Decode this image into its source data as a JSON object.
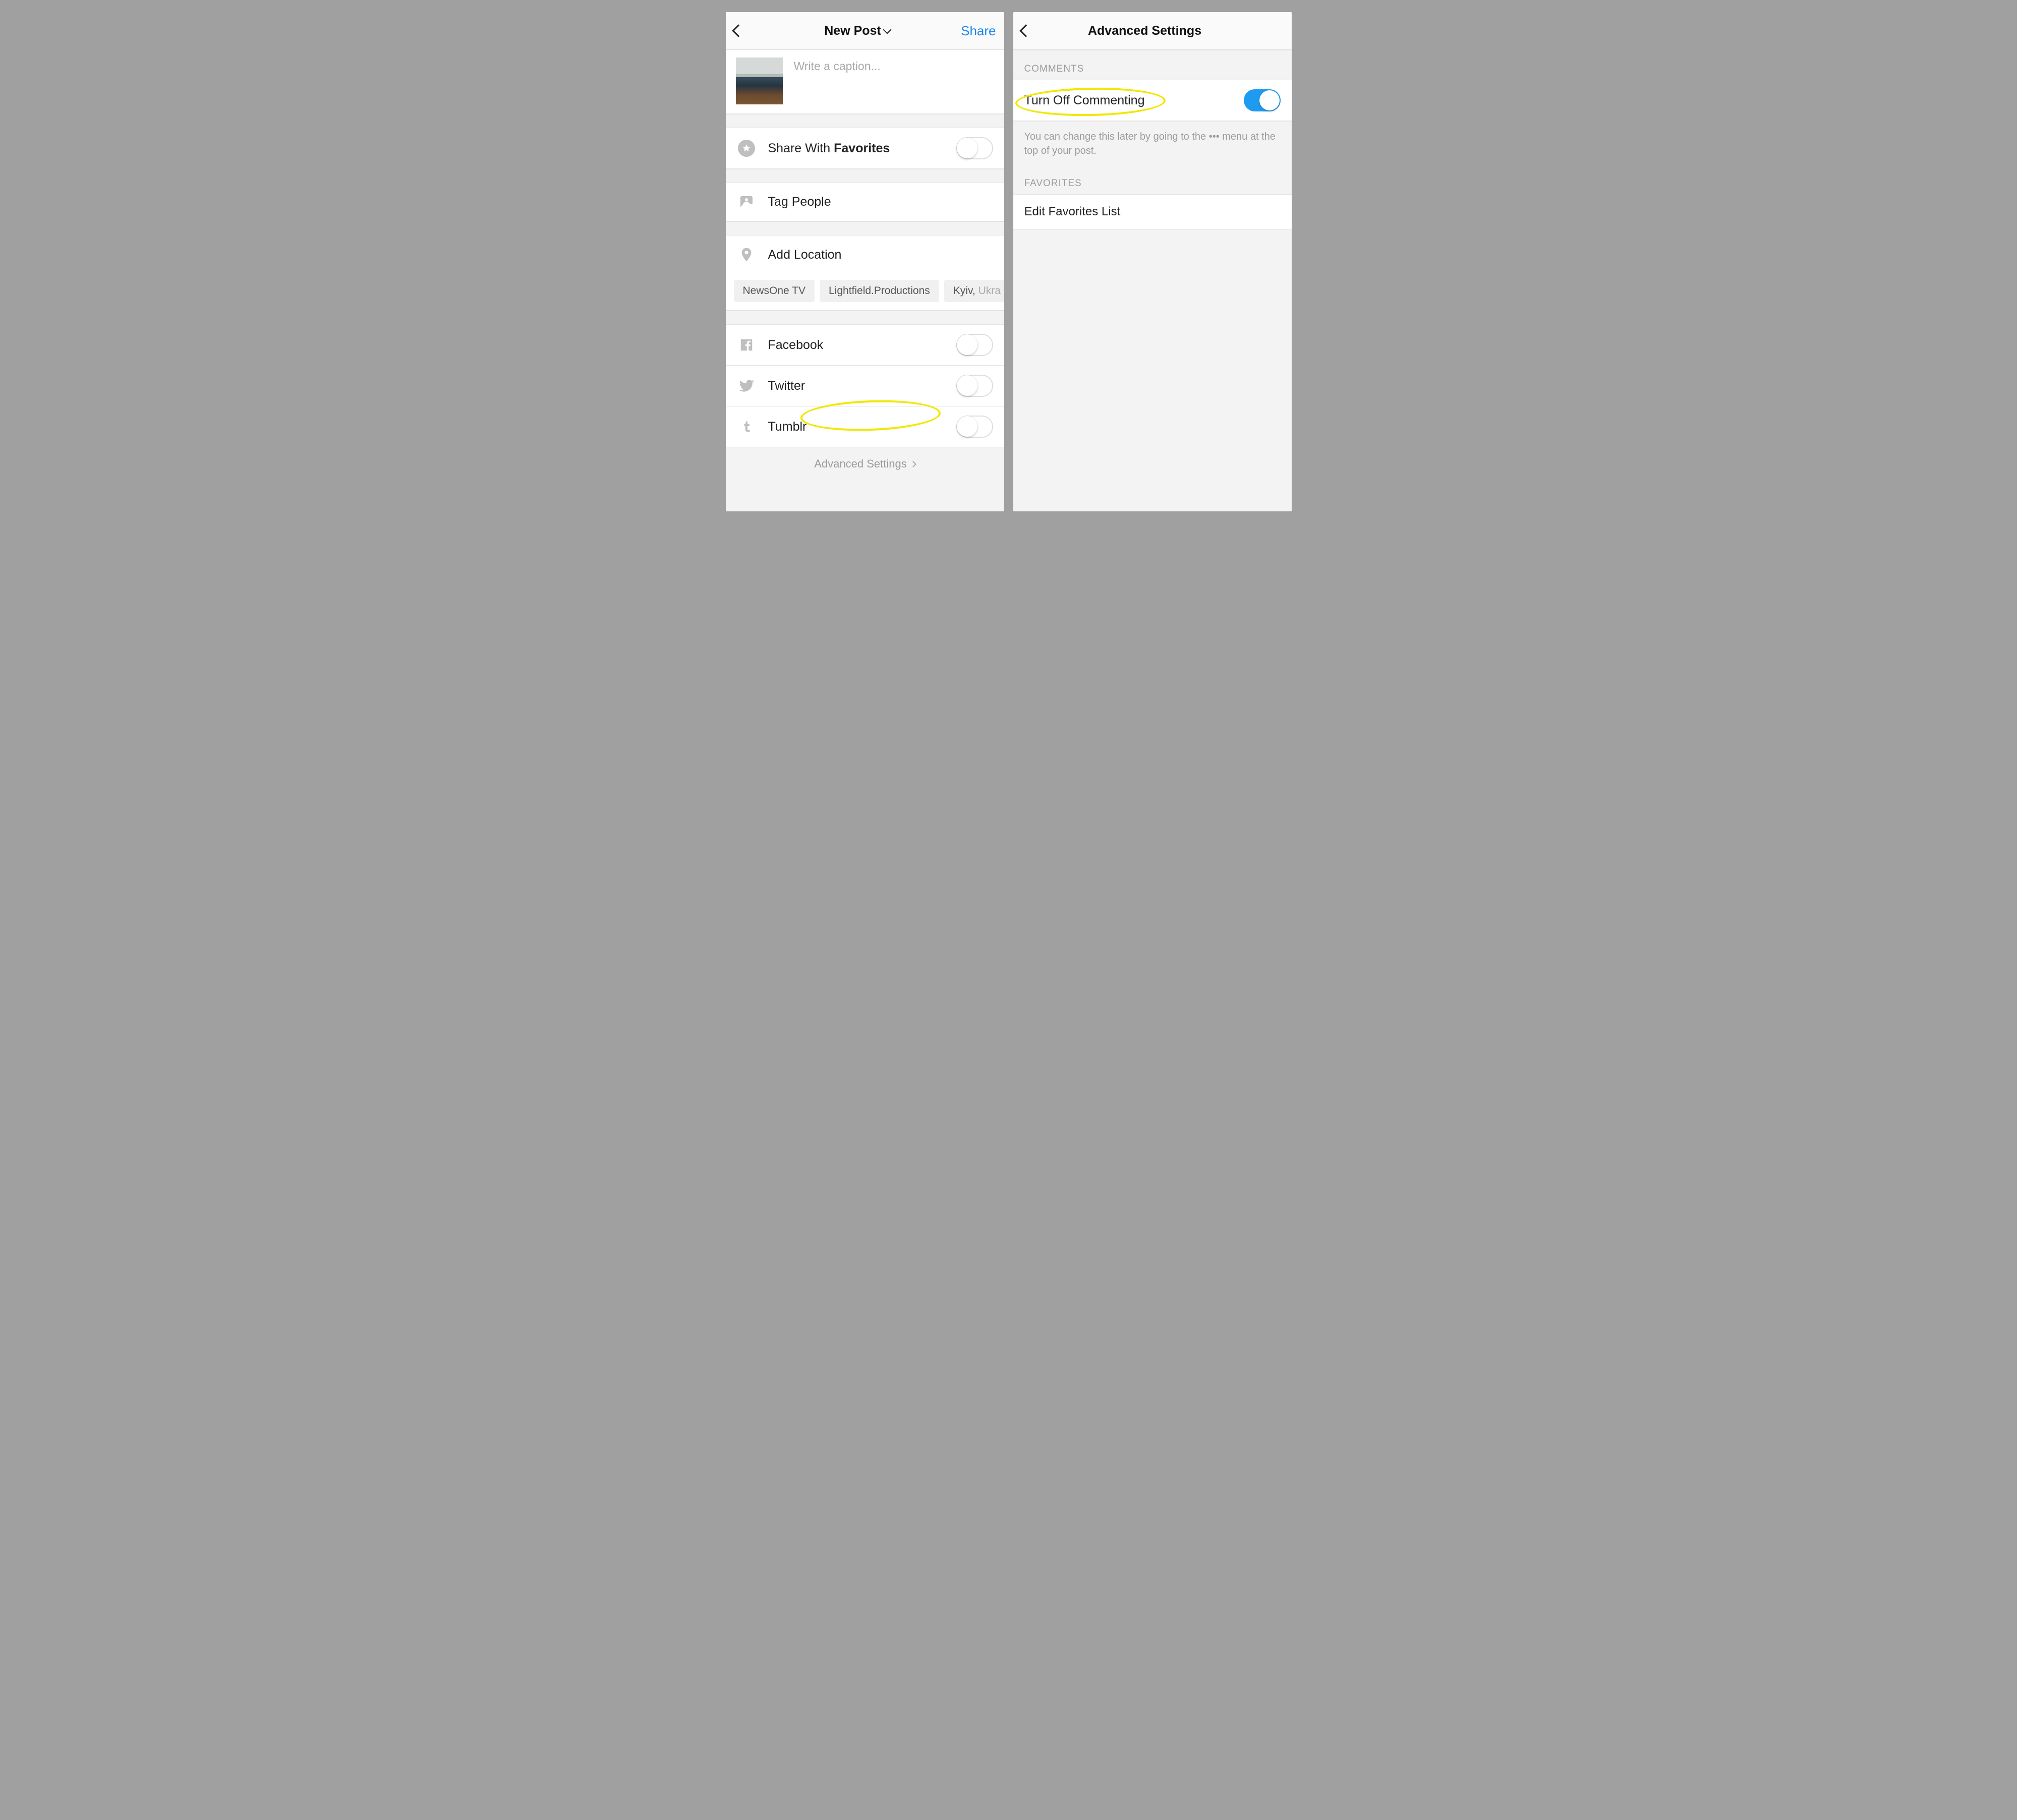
{
  "left": {
    "header": {
      "title": "New Post",
      "share_label": "Share"
    },
    "caption": {
      "placeholder": "Write a caption..."
    },
    "favorites": {
      "label_prefix": "Share With ",
      "label_bold": "Favorites"
    },
    "tag_people": {
      "label": "Tag People"
    },
    "add_location": {
      "label": "Add Location"
    },
    "locations": [
      {
        "text": "NewsOne TV"
      },
      {
        "text": "Lightfield.Productions"
      },
      {
        "text_dark": "Kyiv, ",
        "text_light": "Ukra"
      }
    ],
    "social": {
      "facebook": {
        "label": "Facebook"
      },
      "twitter": {
        "label": "Twitter"
      },
      "tumblr": {
        "label": "Tumblr"
      }
    },
    "advanced_settings_link": "Advanced Settings"
  },
  "right": {
    "header": {
      "title": "Advanced Settings"
    },
    "comments_section": "COMMENTS",
    "turn_off_commenting": {
      "label": "Turn Off Commenting"
    },
    "comments_hint": "You can change this later by going to the ••• menu at the top of your post.",
    "favorites_section": "FAVORITES",
    "edit_favorites": {
      "label": "Edit Favorites List"
    }
  },
  "colors": {
    "accent": "#1e87f0",
    "toggle_on": "#1e9bf0",
    "highlight": "#f2e700"
  }
}
